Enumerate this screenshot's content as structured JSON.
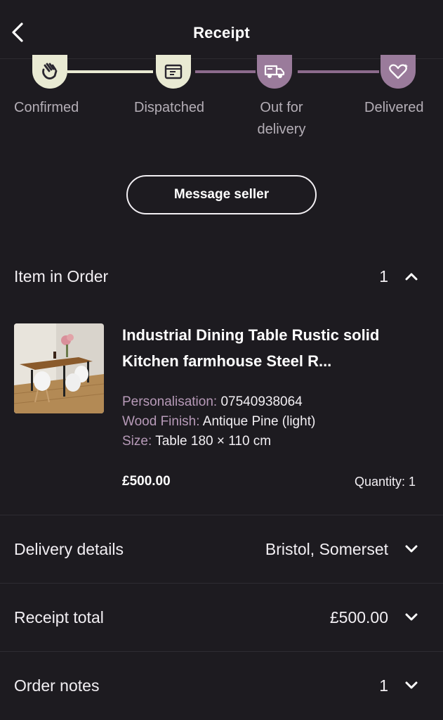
{
  "header": {
    "title": "Receipt"
  },
  "tracker": {
    "steps": [
      {
        "label": "Confirmed",
        "icon": "waving-hand-icon",
        "status": "done"
      },
      {
        "label": "Dispatched",
        "icon": "package-box-icon",
        "status": "done"
      },
      {
        "label": "Out for delivery",
        "icon": "delivery-van-icon",
        "status": "pending"
      },
      {
        "label": "Delivered",
        "icon": "heart-icon",
        "status": "pending"
      }
    ],
    "colors": {
      "done": "#e9ead3",
      "pending": "#9a7b9b",
      "line_pending": "#8c6b8c"
    }
  },
  "message_seller": {
    "label": "Message seller"
  },
  "items_section": {
    "label": "Item in Order",
    "count": "1"
  },
  "item": {
    "title": "Industrial Dining Table Rustic solid Kitchen farmhouse Steel R...",
    "image_icon": "dining-table-photo",
    "attributes": [
      {
        "key": "Personalisation:",
        "value": "07540938064"
      },
      {
        "key": "Wood Finish:",
        "value": "Antique Pine (light)"
      },
      {
        "key": "Size:",
        "value": "Table 180 × 110 cm"
      }
    ],
    "price": "£500.00",
    "quantity": "Quantity: 1"
  },
  "delivery": {
    "label": "Delivery details",
    "value": "Bristol, Somerset"
  },
  "receipt_total": {
    "label": "Receipt total",
    "value": "£500.00"
  },
  "order_notes": {
    "label": "Order notes",
    "value": "1"
  },
  "colors": {
    "background": "#1d1b20",
    "attribute_key": "#b79ab8",
    "text": "#f2eff3"
  }
}
